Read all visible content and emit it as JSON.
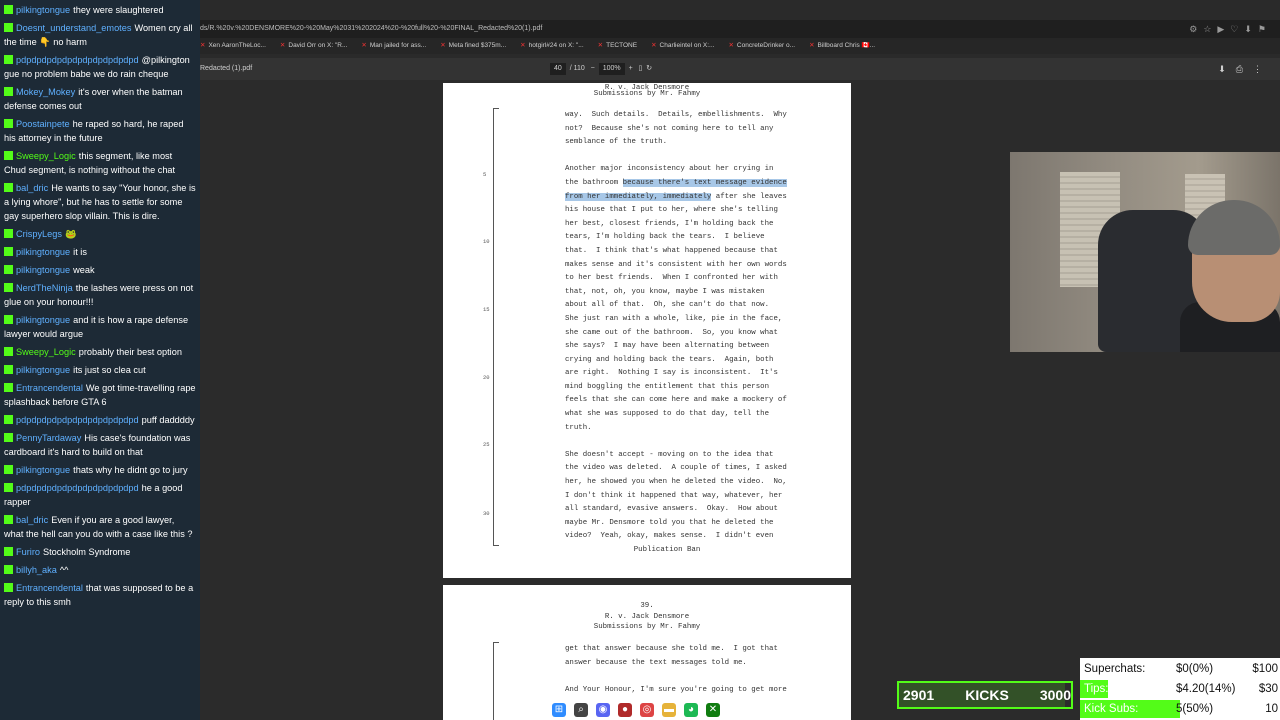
{
  "chat": [
    {
      "user": "pilkingtongue",
      "color": "#5fb0ff",
      "text": "they were slaughtered"
    },
    {
      "user": "Doesnt_understand_emotes",
      "color": "#5fb0ff",
      "text": "Women cry all the time 👇 no harm"
    },
    {
      "user": "pdpdpdpdpdpdpdpdpdpdpdpd",
      "color": "#5fb0ff",
      "text": "@pilkington gue no problem babe we do rain cheque"
    },
    {
      "user": "Mokey_Mokey",
      "color": "#5fb0ff",
      "text": "it's over when the batman defense comes out"
    },
    {
      "user": "Poostainpete",
      "color": "#5fb0ff",
      "text": "he raped so hard, he raped his attorney in the future"
    },
    {
      "user": "Sweepy_Logic",
      "color": "#53fc18",
      "text": "this segment, like most Chud segment, is nothing without the chat"
    },
    {
      "user": "bal_dric",
      "color": "#5fb0ff",
      "text": "He wants to say \"Your honor, she is a lying whore\", but he has to settle for some gay superhero slop villain. This is dire."
    },
    {
      "user": "CrispyLegs",
      "color": "#5fb0ff",
      "text": "🐸"
    },
    {
      "user": "pilkingtongue",
      "color": "#5fb0ff",
      "text": "it is"
    },
    {
      "user": "pilkingtongue",
      "color": "#5fb0ff",
      "text": "weak"
    },
    {
      "user": "NerdTheNinja",
      "color": "#5fb0ff",
      "text": "the lashes were press on not glue on your honour!!!"
    },
    {
      "user": "pilkingtongue",
      "color": "#5fb0ff",
      "text": "and it is how a rape defense lawyer would argue"
    },
    {
      "user": "Sweepy_Logic",
      "color": "#53fc18",
      "text": "probably their best option"
    },
    {
      "user": "pilkingtongue",
      "color": "#5fb0ff",
      "text": "its just so clea cut"
    },
    {
      "user": "Entrancendental",
      "color": "#5fb0ff",
      "text": "We got time-travelling rape splashback before GTA 6"
    },
    {
      "user": "pdpdpdpdpdpdpdpdpdpdpdpd",
      "color": "#5fb0ff",
      "text": "puff daddddy"
    },
    {
      "user": "PennyTardaway",
      "color": "#5fb0ff",
      "text": "His case's foundation was cardboard it's hard to build on that"
    },
    {
      "user": "pilkingtongue",
      "color": "#5fb0ff",
      "text": "thats why he didnt go to jury"
    },
    {
      "user": "pdpdpdpdpdpdpdpdpdpdpdpd",
      "color": "#5fb0ff",
      "text": "he a good rapper"
    },
    {
      "user": "bal_dric",
      "color": "#5fb0ff",
      "text": "Even if you are a good lawyer, what the hell can you do with a case like this ?"
    },
    {
      "user": "Furiro",
      "color": "#5fb0ff",
      "text": "Stockholm Syndrome"
    },
    {
      "user": "billyh_aka",
      "color": "#5fb0ff",
      "text": "^^"
    },
    {
      "user": "Entrancendental",
      "color": "#5fb0ff",
      "text": "that was supposed to be a reply to this smh"
    }
  ],
  "browser": {
    "url": "ds/R.%20v.%20DENSMORE%20-%20May%2031%202024%20-%20full%20-%20FINAL_Redacted%20(1).pdf",
    "bookmarks": [
      "Xen AaronTheLoc...",
      "David Orr on X: \"R...",
      "Man jailed for ass...",
      "Meta fined $375m...",
      "hotgirl#24 on X: \"...",
      "TECTONE",
      "Charlieintel on X:...",
      "ConcreteDrinker o...",
      "Billboard Chris 🇨🇦..."
    ],
    "pdf_title": "Redacted (1).pdf",
    "page_current": "40",
    "page_total": "/ 110",
    "zoom": "100%"
  },
  "pdf": {
    "page1": {
      "header": [
        "R. v. Jack Densmore",
        "Submissions by Mr. Fahmy"
      ],
      "line_numbers": [
        "5",
        "10",
        "15",
        "20",
        "25",
        "30"
      ],
      "lines": [
        {
          "pre": "way.  Such details.  Details, embellishments.  Why",
          "hl": "",
          "post": ""
        },
        {
          "pre": "not?  Because she's not coming here to tell any",
          "hl": "",
          "post": ""
        },
        {
          "pre": "semblance of the truth.",
          "hl": "",
          "post": ""
        },
        {
          "pre": "",
          "hl": "",
          "post": ""
        },
        {
          "pre": "Another major inconsistency about her crying in",
          "hl": "",
          "post": ""
        },
        {
          "pre": "the bathroom ",
          "hl": "because there's text message evidence",
          "post": ""
        },
        {
          "pre": "",
          "hl": "from her immediately, immediately",
          "post": " after she leaves"
        },
        {
          "pre": "his house that I put to her, where she's telling",
          "hl": "",
          "post": ""
        },
        {
          "pre": "her best, closest friends, I'm holding back the",
          "hl": "",
          "post": ""
        },
        {
          "pre": "tears, I'm holding back the tears.  I believe",
          "hl": "",
          "post": ""
        },
        {
          "pre": "that.  I think that's what happened because that",
          "hl": "",
          "post": ""
        },
        {
          "pre": "makes sense and it's consistent with her own words",
          "hl": "",
          "post": ""
        },
        {
          "pre": "to her best friends.  When I confronted her with",
          "hl": "",
          "post": ""
        },
        {
          "pre": "that, not, oh, you know, maybe I was mistaken",
          "hl": "",
          "post": ""
        },
        {
          "pre": "about all of that.  Oh, she can't do that now.",
          "hl": "",
          "post": ""
        },
        {
          "pre": "She just ran with a whole, like, pie in the face,",
          "hl": "",
          "post": ""
        },
        {
          "pre": "she came out of the bathroom.  So, you know what",
          "hl": "",
          "post": ""
        },
        {
          "pre": "she says?  I may have been alternating between",
          "hl": "",
          "post": ""
        },
        {
          "pre": "crying and holding back the tears.  Again, both",
          "hl": "",
          "post": ""
        },
        {
          "pre": "are right.  Nothing I say is inconsistent.  It's",
          "hl": "",
          "post": ""
        },
        {
          "pre": "mind boggling the entitlement that this person",
          "hl": "",
          "post": ""
        },
        {
          "pre": "feels that she can come here and make a mockery of",
          "hl": "",
          "post": ""
        },
        {
          "pre": "what she was supposed to do that day, tell the",
          "hl": "",
          "post": ""
        },
        {
          "pre": "truth.",
          "hl": "",
          "post": ""
        },
        {
          "pre": "",
          "hl": "",
          "post": ""
        },
        {
          "pre": "She doesn't accept - moving on to the idea that",
          "hl": "",
          "post": ""
        },
        {
          "pre": "the video was deleted.  A couple of times, I asked",
          "hl": "",
          "post": ""
        },
        {
          "pre": "her, he showed you when he deleted the video.  No,",
          "hl": "",
          "post": ""
        },
        {
          "pre": "I don't think it happened that way, whatever, her",
          "hl": "",
          "post": ""
        },
        {
          "pre": "all standard, evasive answers.  Okay.  How about",
          "hl": "",
          "post": ""
        },
        {
          "pre": "maybe Mr. Densmore told you that he deleted the",
          "hl": "",
          "post": ""
        },
        {
          "pre": "video?  Yeah, okay, makes sense.  I didn't even",
          "hl": "",
          "post": ""
        }
      ],
      "footer": "Publication Ban"
    },
    "page2": {
      "page_number": "39.",
      "header": [
        "R. v. Jack Densmore",
        "Submissions by Mr. Fahmy"
      ],
      "lines": [
        "get that answer because she told me.  I got that",
        "answer because the text messages told me.",
        "",
        "And Your Honour, I'm sure you're going to get more"
      ]
    }
  },
  "kicks": {
    "current": "2901",
    "label": "KICKS",
    "goal": "3000",
    "progress": 0.967
  },
  "goals": [
    {
      "label": "Superchats:",
      "value": "$0(0%)",
      "target": "$100",
      "progress": 0.0
    },
    {
      "label": "Tips:",
      "value": "$4.20(14%)",
      "target": "$30",
      "progress": 0.14
    },
    {
      "label": "Kick Subs:",
      "value": "5(50%)",
      "target": "10",
      "progress": 0.5
    }
  ],
  "taskbar": [
    {
      "name": "start-icon",
      "glyph": "⊞",
      "color": "#2f8cff"
    },
    {
      "name": "search-icon",
      "glyph": "⌕",
      "color": "#444"
    },
    {
      "name": "discord-icon",
      "glyph": "◉",
      "color": "#5865f2"
    },
    {
      "name": "obs-icon",
      "glyph": "●",
      "color": "#b02a2a"
    },
    {
      "name": "chrome-icon",
      "glyph": "◎",
      "color": "#d44"
    },
    {
      "name": "folder-icon",
      "glyph": "▬",
      "color": "#e6b33a"
    },
    {
      "name": "spotify-icon",
      "glyph": "◕",
      "color": "#1db954"
    },
    {
      "name": "xbox-icon",
      "glyph": "✕",
      "color": "#107c10"
    }
  ]
}
